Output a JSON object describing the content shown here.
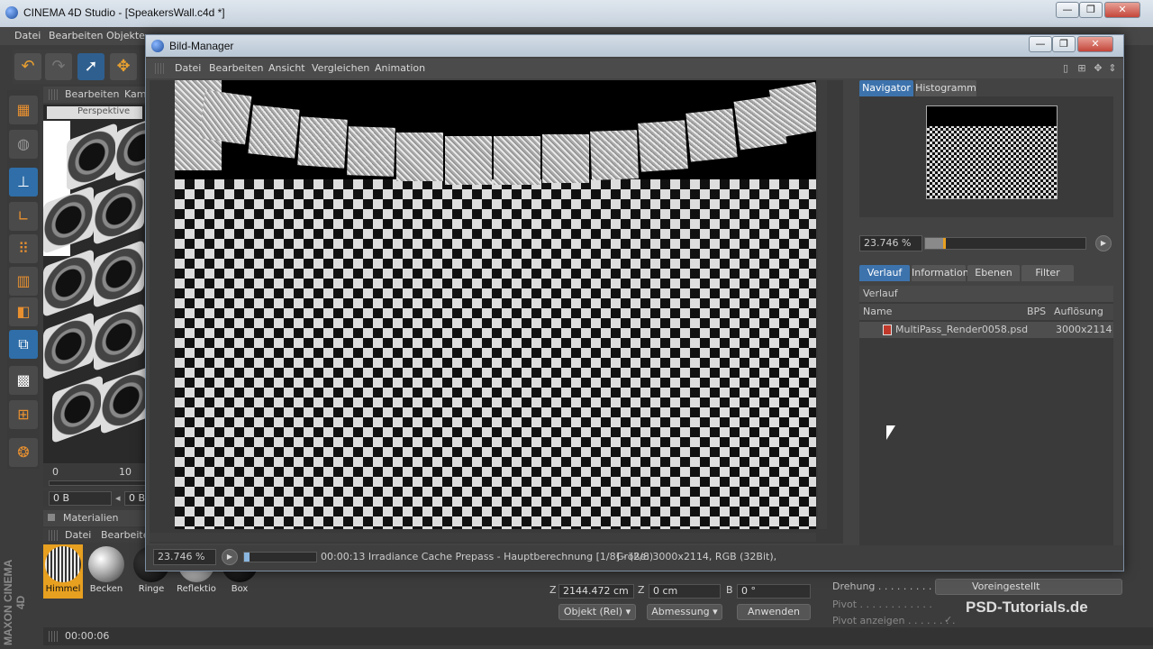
{
  "app": {
    "title": "CINEMA 4D Studio - [SpeakersWall.c4d *]",
    "menu": [
      "Datei",
      "Bearbeiten",
      "Objekte"
    ],
    "window_controls": {
      "minimize": "—",
      "maximize": "❐",
      "close": "✕"
    }
  },
  "viewport": {
    "panel_menu": [
      "Bearbeiten",
      "Kam"
    ],
    "camera_label": "Perspektive"
  },
  "timeline": {
    "tick_0": "0",
    "tick_10": "10",
    "frame_field": "0 B",
    "frame_field_2": "0 B"
  },
  "materials": {
    "panel_title": "Materialien",
    "menu": [
      "Datei",
      "Bearbeiten"
    ],
    "items": [
      {
        "label": "Himmel",
        "selected": true
      },
      {
        "label": "Becken",
        "selected": false
      },
      {
        "label": "Ringe",
        "selected": false
      },
      {
        "label": "Reflektio",
        "selected": false
      },
      {
        "label": "Box",
        "selected": false
      }
    ]
  },
  "coords": {
    "z_label": "Z",
    "z_position": "2144.472 cm",
    "z2_label": "Z",
    "z_size": "0 cm",
    "b_label": "B",
    "b_rotation": "0 °",
    "objekt_button": "Objekt (Rel)",
    "abmessung_button": "Abmessung",
    "anwenden_button": "Anwenden"
  },
  "attributes": {
    "drehung_label": "Drehung . . . . . . . . . .",
    "drehung_value": "Voreingestellt",
    "pivot_label": "Pivot . . . . . . . . . . . .",
    "pivot_anzeigen_label": "Pivot anzeigen . . . . . . . .",
    "pivot_anzeigen_check": "✓"
  },
  "status_bottom": {
    "time": "00:00:06"
  },
  "brand": {
    "maxon": "MAXON CINEMA 4D",
    "watermark": "PSD-Tutorials.de"
  },
  "dialog": {
    "title": "Bild-Manager",
    "menu": [
      "Datei",
      "Bearbeiten",
      "Ansicht",
      "Vergleichen",
      "Animation"
    ],
    "status": {
      "zoom": "23.746 %",
      "progress_fraction": 0.08,
      "message": "00:00:13 Irradiance Cache Prepass - Hauptberechnung [1/8] - (2/8)",
      "info": "Größe: 3000x2114, RGB (32Bit),"
    }
  },
  "side": {
    "tabs_top": [
      {
        "label": "Navigator",
        "active": true
      },
      {
        "label": "Histogramm",
        "active": false
      }
    ],
    "nav_zoom": "23.746 %",
    "tabs_bottom": [
      {
        "label": "Verlauf",
        "active": true
      },
      {
        "label": "Information",
        "active": false
      },
      {
        "label": "Ebenen",
        "active": false
      },
      {
        "label": "Filter",
        "active": false
      }
    ],
    "list_title": "Verlauf",
    "columns": [
      "Name",
      "BPS",
      "Auflösung"
    ],
    "rows": [
      {
        "name": "MultiPass_Render0058.psd",
        "bps": "",
        "resolution": "3000x2114"
      }
    ]
  },
  "colors": {
    "accent": "#3d73ad",
    "selection": "#e8a020",
    "dialog_border": "#7c8ea3"
  }
}
